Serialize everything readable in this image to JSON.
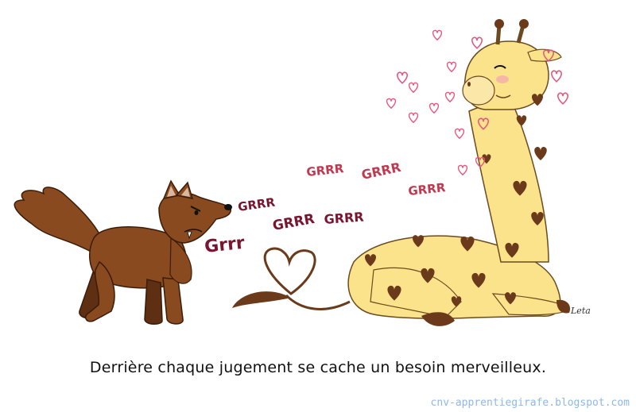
{
  "illustration": {
    "caption": "Derrière chaque jugement se cache un besoin merveilleux.",
    "website": "cnv-apprentiegirafe.blogspot.com",
    "signature": "Leta",
    "jackal_words": [
      "Grrr",
      "GRRR",
      "GRRR",
      "GRRR"
    ],
    "giraffe_words": [
      "GRRR",
      "GRRR",
      "GRRR"
    ],
    "colors": {
      "jackal_fur": "#8a4a1f",
      "giraffe_body": "#fbe38c",
      "giraffe_spots": "#6b3a1a",
      "grrr_dark": "#7a1530",
      "grrr_light": "#c0394f",
      "hearts": "#e8577a"
    }
  }
}
